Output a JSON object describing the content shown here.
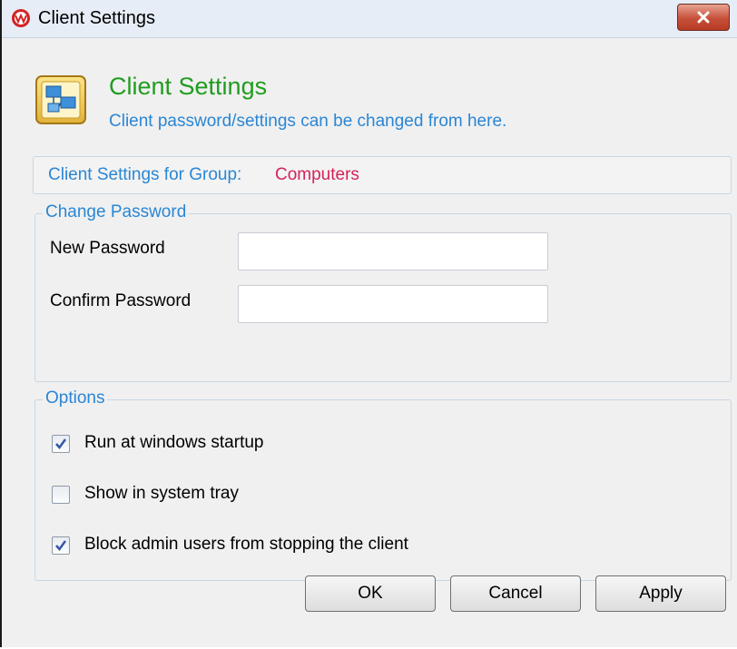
{
  "window": {
    "title": "Client Settings",
    "icon": "app-logo-icon",
    "close_icon": "close-icon"
  },
  "header": {
    "title": "Client Settings",
    "subtitle": "Client password/settings can be changed from here.",
    "icon": "network-computers-icon",
    "title_color": "#1f9d1f",
    "accent_color": "#2a86d4"
  },
  "group": {
    "label": "Client Settings for Group:",
    "value": "Computers",
    "value_color": "#d3235a"
  },
  "change_password": {
    "legend": "Change Password",
    "new_password_label": "New Password",
    "new_password_value": "",
    "confirm_password_label": "Confirm Password",
    "confirm_password_value": ""
  },
  "options": {
    "legend": "Options",
    "items": [
      {
        "label": "Run at windows startup",
        "checked": true
      },
      {
        "label": "Show in system tray",
        "checked": false
      },
      {
        "label": "Block admin users from stopping the client",
        "checked": true
      }
    ]
  },
  "buttons": {
    "ok": "OK",
    "cancel": "Cancel",
    "apply": "Apply"
  }
}
